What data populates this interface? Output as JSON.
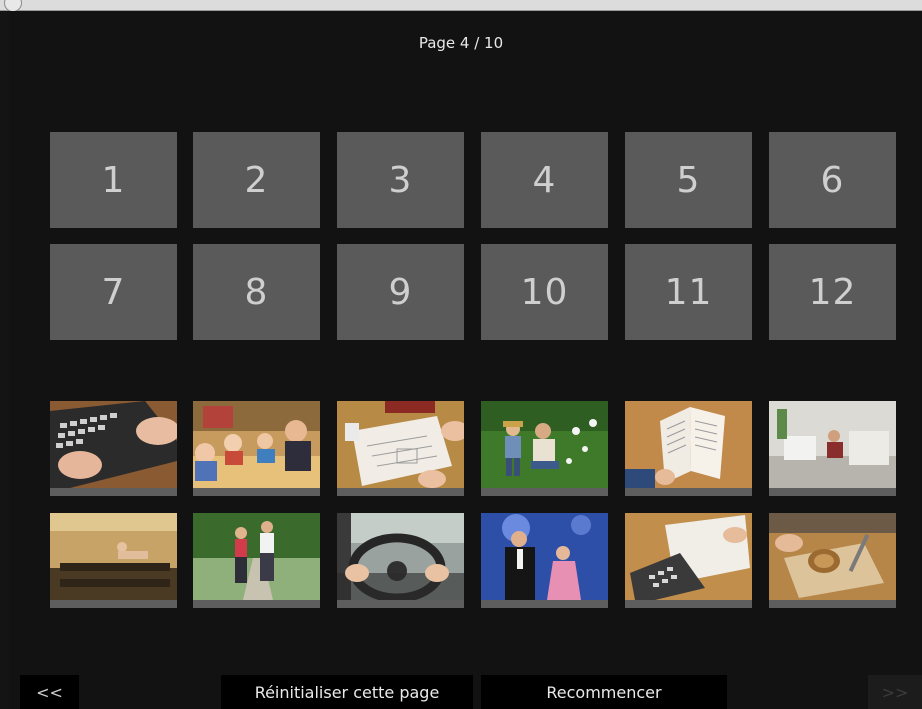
{
  "header": {
    "page_label": "Page 4 / 10"
  },
  "slots": [
    "1",
    "2",
    "3",
    "4",
    "5",
    "6",
    "7",
    "8",
    "9",
    "10",
    "11",
    "12"
  ],
  "thumbnails": [
    {
      "name": "typing-keyboard-image",
      "scene": "keyboard"
    },
    {
      "name": "classroom-children-image",
      "scene": "classroom"
    },
    {
      "name": "drawing-paper-image",
      "scene": "drawing"
    },
    {
      "name": "garden-family-image",
      "scene": "garden"
    },
    {
      "name": "reading-book-image",
      "scene": "book"
    },
    {
      "name": "bathroom-cleaning-image",
      "scene": "bathroom"
    },
    {
      "name": "sauna-image",
      "scene": "sauna"
    },
    {
      "name": "jogging-couple-image",
      "scene": "jogging"
    },
    {
      "name": "driving-car-image",
      "scene": "driving"
    },
    {
      "name": "singers-stage-image",
      "scene": "stage"
    },
    {
      "name": "calculator-writing-image",
      "scene": "calculator"
    },
    {
      "name": "woodwork-image",
      "scene": "woodwork"
    }
  ],
  "footer": {
    "prev_label": "<<",
    "reset_label": "Réinitialiser cette page",
    "restart_label": "Recommencer",
    "next_label": ">>"
  }
}
